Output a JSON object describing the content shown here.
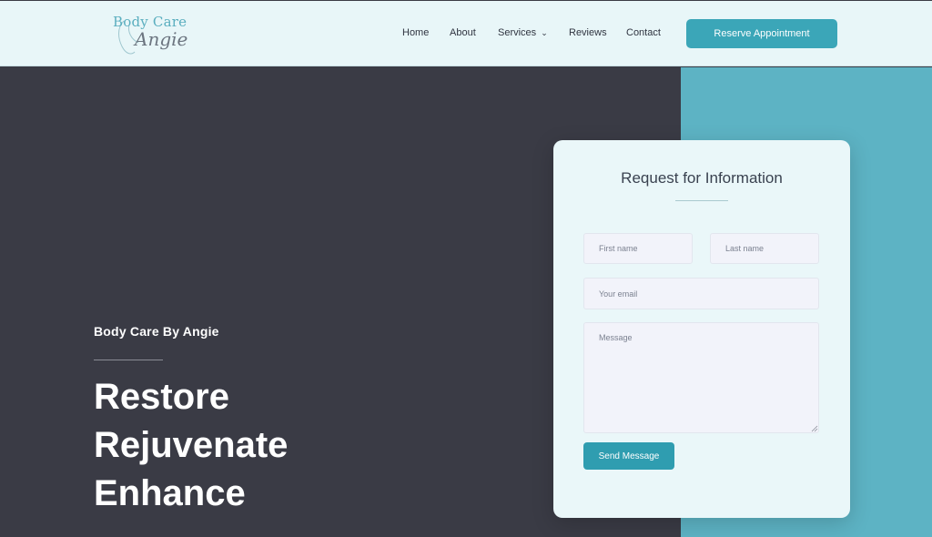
{
  "colors": {
    "nav_bg": "#e8f6f8",
    "hero_dark": "#3a3b45",
    "hero_teal": "#5db3c4",
    "accent_button": "#3ba6b8",
    "send_button": "#2f9db0",
    "form_bg": "#eaf7f9"
  },
  "header": {
    "logo": {
      "line1": "Body Care",
      "line2": "Angie"
    },
    "nav": [
      {
        "label": "Home"
      },
      {
        "label": "About"
      },
      {
        "label": "Services",
        "icon": "chevron-down-icon"
      },
      {
        "label": "Reviews"
      },
      {
        "label": "Contact"
      }
    ],
    "cta_label": "Reserve Appointment"
  },
  "hero": {
    "brand": "Body Care By Angie",
    "headline": [
      "Restore",
      "Rejuvenate",
      "Enhance"
    ]
  },
  "form": {
    "title": "Request for Information",
    "first_name_placeholder": "First name",
    "last_name_placeholder": "Last name",
    "email_placeholder": "Your email",
    "message_placeholder": "Message",
    "submit_label": "Send Message"
  }
}
